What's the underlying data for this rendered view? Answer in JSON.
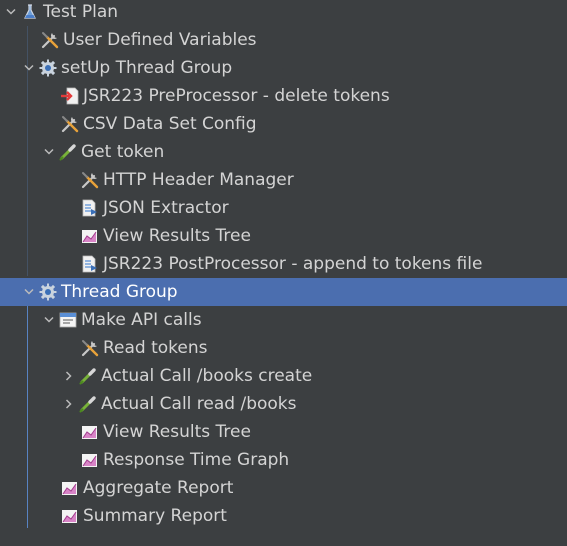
{
  "tree": {
    "items": [
      {
        "label": "Test Plan",
        "icon": "flask-icon",
        "expander": "expanded"
      },
      {
        "label": "User Defined Variables",
        "icon": "wrench-screwdriver-icon",
        "expander": "none"
      },
      {
        "label": "setUp Thread Group",
        "icon": "gear-icon",
        "expander": "expanded"
      },
      {
        "label": "JSR223 PreProcessor - delete tokens",
        "icon": "preprocessor-icon",
        "expander": "none"
      },
      {
        "label": "CSV Data Set Config",
        "icon": "wrench-screwdriver-icon",
        "expander": "none"
      },
      {
        "label": "Get token",
        "icon": "sampler-pipette-icon",
        "expander": "expanded"
      },
      {
        "label": "HTTP Header Manager",
        "icon": "wrench-screwdriver-icon",
        "expander": "none"
      },
      {
        "label": "JSON Extractor",
        "icon": "postprocessor-icon",
        "expander": "none"
      },
      {
        "label": "View Results Tree",
        "icon": "listener-graph-icon",
        "expander": "none"
      },
      {
        "label": "JSR223 PostProcessor - append to tokens file",
        "icon": "postprocessor-icon",
        "expander": "none"
      },
      {
        "label": "Thread Group",
        "icon": "gear-icon",
        "expander": "expanded",
        "selected": true
      },
      {
        "label": "Make API calls",
        "icon": "transaction-controller-icon",
        "expander": "expanded"
      },
      {
        "label": "Read tokens",
        "icon": "wrench-screwdriver-icon",
        "expander": "none"
      },
      {
        "label": "Actual Call /books create",
        "icon": "sampler-pipette-icon",
        "expander": "collapsed"
      },
      {
        "label": "Actual Call read /books",
        "icon": "sampler-pipette-icon",
        "expander": "collapsed"
      },
      {
        "label": "View Results Tree",
        "icon": "listener-graph-icon",
        "expander": "none"
      },
      {
        "label": "Response Time Graph",
        "icon": "listener-graph-icon",
        "expander": "none"
      },
      {
        "label": "Aggregate Report",
        "icon": "listener-graph-icon",
        "expander": "none"
      },
      {
        "label": "Summary Report",
        "icon": "listener-graph-icon",
        "expander": "none"
      }
    ]
  },
  "colors": {
    "background": "#3c3f41",
    "selection": "#4b6eaf",
    "text": "#d4d4d4",
    "guide_line": "#5b8bd0"
  }
}
